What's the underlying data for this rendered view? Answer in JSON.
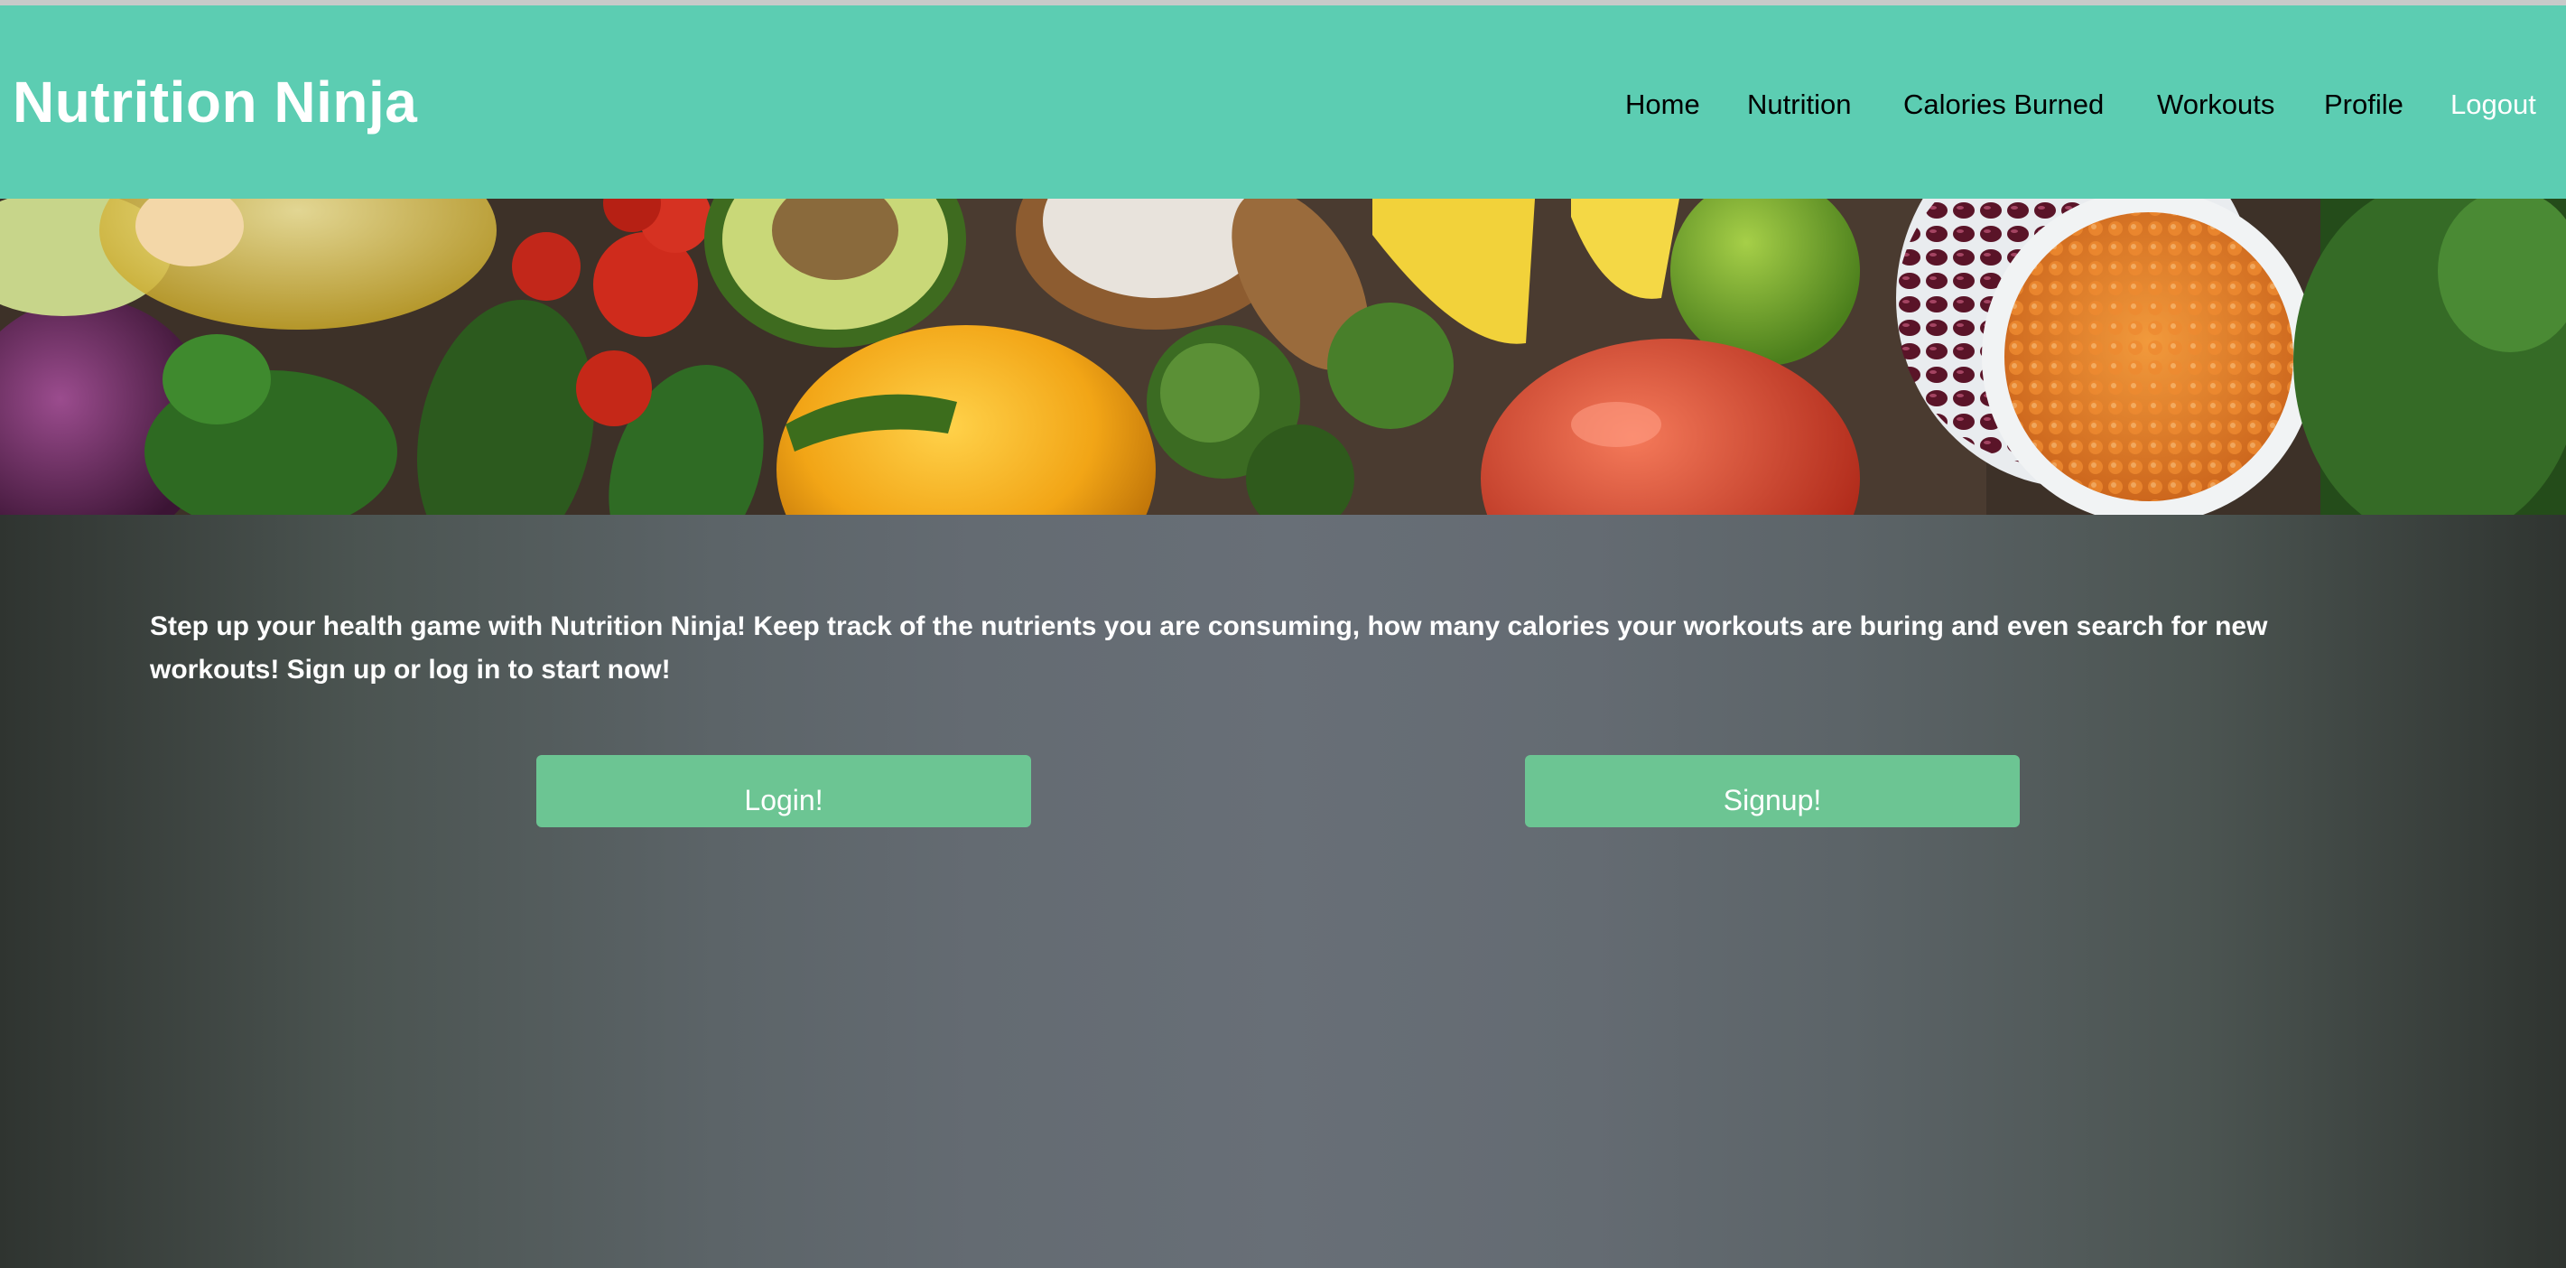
{
  "header": {
    "brand": "Nutrition Ninja",
    "nav": [
      {
        "label": "Home"
      },
      {
        "label": "Nutrition"
      },
      {
        "label": "Calories Burned"
      },
      {
        "label": "Workouts"
      },
      {
        "label": "Profile"
      },
      {
        "label": "Logout"
      }
    ]
  },
  "banner": {
    "icon": "vegetables-banner-image"
  },
  "hero": {
    "intro": "Step up your health game with Nutrition Ninja! Keep track of the nutrients you are consuming, how many calories your workouts are buring and even search for new workouts! Sign up or log in to start now!",
    "login_label": "Login!",
    "signup_label": "Signup!"
  },
  "colors": {
    "header_bg": "#5ccdb2",
    "button_bg": "#6cc593",
    "text_light": "#ffffff"
  }
}
